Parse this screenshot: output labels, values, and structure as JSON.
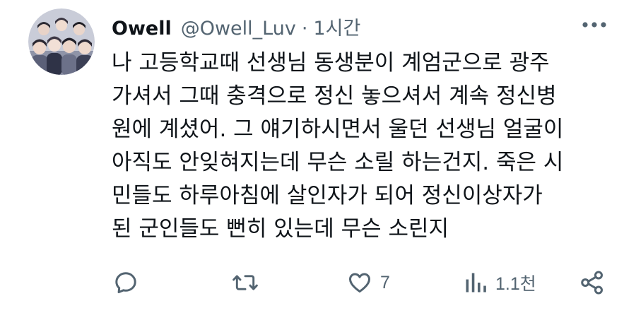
{
  "tweet": {
    "display_name": "Owell",
    "handle": "@Owell_Luv",
    "separator": "·",
    "time": "1시간",
    "lines": [
      "나 고등학교때 선생님 동생분이 계엄군으로 광주",
      "가셔서 그때 충격으로 정신 놓으셔서 계속 정신병",
      "원에 계셨어. 그 얘기하시면서 울던 선생님 얼굴이",
      "아직도 안잊혀지는데 무슨 소릴 하는건지. 죽은 시",
      "민들도 하루아침에 살인자가 되어 정신이상자가",
      "된 군인들도 뻔히 있는데 무슨 소린지"
    ]
  },
  "actions": {
    "reply_count": "",
    "retweet_count": "",
    "like_count": "7",
    "views_count": "1.1천"
  },
  "colors": {
    "text": "#0f1419",
    "secondary": "#536471"
  }
}
